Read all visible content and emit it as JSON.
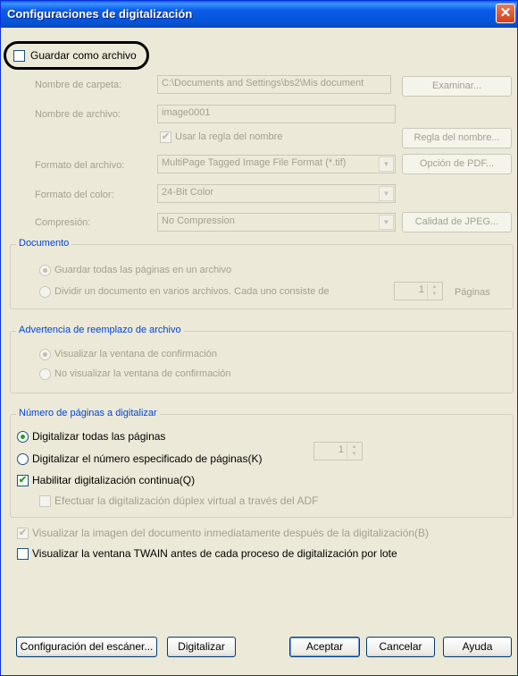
{
  "window": {
    "title": "Configuraciones de digitalización",
    "close_glyph": "✕"
  },
  "save_as_file": {
    "label": "Guardar como archivo",
    "checked": false
  },
  "folder": {
    "label": "Nombre de carpeta:",
    "value": "C:\\Documents and Settings\\bs2\\Mis document",
    "browse_label": "Examinar..."
  },
  "filename": {
    "label": "Nombre de archivo:",
    "value": "image0001",
    "use_rule_label": "Usar la regla del nombre",
    "use_rule_checked": true,
    "rule_button_label": "Regla del nombre..."
  },
  "file_format": {
    "label": "Formato del archivo:",
    "value": "MultiPage Tagged Image File Format (*.tif)",
    "pdf_option_label": "Opción de PDF..."
  },
  "color_format": {
    "label": "Formato del color:",
    "value": "24-Bit Color"
  },
  "compression": {
    "label": "Compresión:",
    "value": "No Compression",
    "jpeg_quality_label": "Calidad de JPEG..."
  },
  "document_group": {
    "title": "Documento",
    "save_all_label": "Guardar todas las páginas en un archivo",
    "split_label": "Dividir un documento en varios archivos. Cada uno consiste de",
    "pages_count": "1",
    "pages_label": "Páginas"
  },
  "overwrite_group": {
    "title": "Advertencia de reemplazo de archivo",
    "show_confirm_label": "Visualizar la ventana de confirmación",
    "hide_confirm_label": "No visualizar la ventana de confirmación"
  },
  "pages_group": {
    "title": "Número de páginas a digitalizar",
    "all_pages_label": "Digitalizar todas las páginas",
    "specified_label": "Digitalizar el número especificado de páginas(K)",
    "specified_count": "1",
    "continuous_label": "Habilitar digitalización continua(Q)",
    "continuous_checked": true,
    "duplex_label": "Efectuar la digitalización dúplex virtual a través del ADF"
  },
  "show_image_after": {
    "label": "Visualizar la imagen del documento inmediatamente después de la digitalización(B)",
    "checked": true
  },
  "show_twain": {
    "label": "Visualizar la ventana TWAIN antes de cada proceso de digitalización por lote",
    "checked": false
  },
  "buttons": {
    "scanner_config": "Configuración del escáner...",
    "scan": "Digitalizar",
    "ok": "Aceptar",
    "cancel": "Cancelar",
    "help": "Ayuda"
  },
  "icons": {
    "check": "✔",
    "combo_arrow": "▼",
    "spin_up": "▲",
    "spin_down": "▼"
  }
}
